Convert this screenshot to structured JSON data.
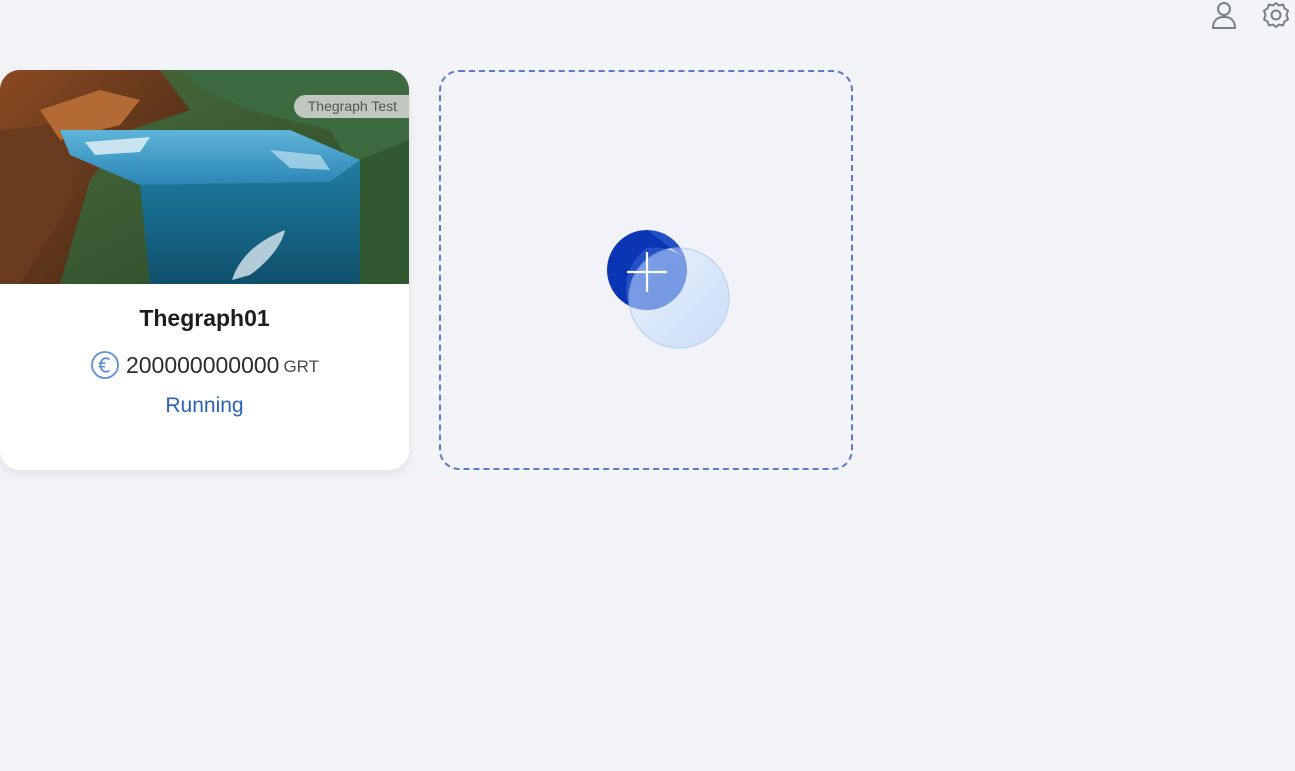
{
  "header": {
    "icons": [
      "user-icon",
      "settings-icon"
    ]
  },
  "card": {
    "tag": "Thegraph Test",
    "title": "Thegraph01",
    "balance": "200000000000",
    "unit": "GRT",
    "status": "Running",
    "icon": "euro-coin-icon"
  },
  "add_card": {
    "icon": "plus-icon"
  },
  "colors": {
    "background": "#f3f4f7",
    "status": "#2b62b8",
    "dashed_border": "#5b7bc4",
    "add_button_dark": "#0a35b5",
    "add_button_light": "#d3e3fb"
  }
}
